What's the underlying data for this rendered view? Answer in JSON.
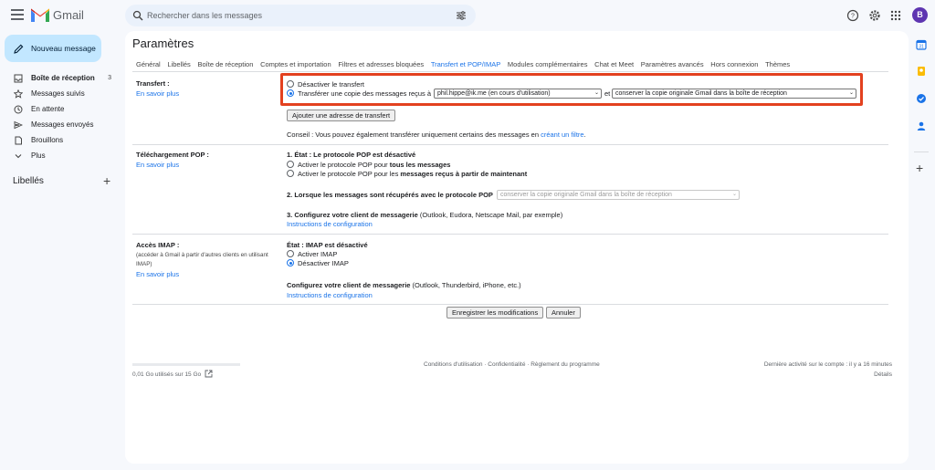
{
  "app": {
    "name": "Gmail",
    "search_placeholder": "Rechercher dans les messages",
    "avatar_letter": "B"
  },
  "sidebar": {
    "compose_label": "Nouveau message",
    "items": [
      {
        "label": "Boîte de réception",
        "count": "3",
        "icon": "inbox-icon"
      },
      {
        "label": "Messages suivis",
        "icon": "star-icon"
      },
      {
        "label": "En attente",
        "icon": "clock-icon"
      },
      {
        "label": "Messages envoyés",
        "icon": "send-icon"
      },
      {
        "label": "Brouillons",
        "icon": "draft-icon"
      },
      {
        "label": "Plus",
        "icon": "chevron-down-icon"
      }
    ],
    "labels_heading": "Libellés",
    "labels_add": "+"
  },
  "settings": {
    "title": "Paramètres",
    "tabs": [
      "Général",
      "Libellés",
      "Boîte de réception",
      "Comptes et importation",
      "Filtres et adresses bloquées",
      "Transfert et POP/IMAP",
      "Modules complémentaires",
      "Chat et Meet",
      "Paramètres avancés",
      "Hors connexion",
      "Thèmes"
    ],
    "active_tab": "Transfert et POP/IMAP",
    "learn_more": "En savoir plus",
    "forwarding": {
      "label": "Transfert :",
      "option_disable": "Désactiver le transfert",
      "option_forward": "Transférer une copie des messages reçus à",
      "address_select": "phil.hippe@ik.me (en cours d'utilisation)",
      "and": "et",
      "action_select": "conserver la copie originale Gmail dans la boîte de réception",
      "add_button": "Ajouter une adresse de transfert",
      "tip_prefix": "Conseil : Vous pouvez également transférer uniquement certains des messages en ",
      "tip_link": "créant un filtre",
      "tip_suffix": ".",
      "selected": "forward"
    },
    "pop": {
      "label": "Téléchargement POP :",
      "status": "1. État : Le protocole POP est désactivé",
      "opt_all_prefix": "Activer le protocole POP pour ",
      "opt_all_bold": "tous les messages",
      "opt_new_prefix": "Activer le protocole POP pour les ",
      "opt_new_bold": "messages reçus à partir de maintenant",
      "when_label": "2. Lorsque les messages sont récupérés avec le protocole POP",
      "when_select": "conserver la copie originale Gmail dans la boîte de réception",
      "client_bold": "3. Configurez votre client de messagerie",
      "client_rest": " (Outlook, Eudora, Netscape Mail, par exemple)",
      "instructions": "Instructions de configuration"
    },
    "imap": {
      "label": "Accès IMAP :",
      "note": "(accéder à Gmail à partir d'autres clients en utilisant IMAP)",
      "status": "État : IMAP est désactivé",
      "opt_enable": "Activer IMAP",
      "opt_disable": "Désactiver IMAP",
      "client_bold": "Configurez votre client de messagerie",
      "client_rest": " (Outlook, Thunderbird, iPhone, etc.)",
      "instructions": "Instructions de configuration",
      "selected": "disable"
    },
    "save_button": "Enregistrer les modifications",
    "cancel_button": "Annuler"
  },
  "footer": {
    "storage": "0,01 Go utilisés sur 15 Go",
    "links": "Conditions d'utilisation · Confidentialité · Règlement du programme",
    "last_activity": "Dernière activité sur le compte : il y a 16 minutes",
    "details": "Détails"
  },
  "colors": {
    "accent": "#1a73e8",
    "compose_bg": "#c2e7ff",
    "highlight_border": "#e3411f",
    "avatar_bg": "#5e35b1"
  }
}
